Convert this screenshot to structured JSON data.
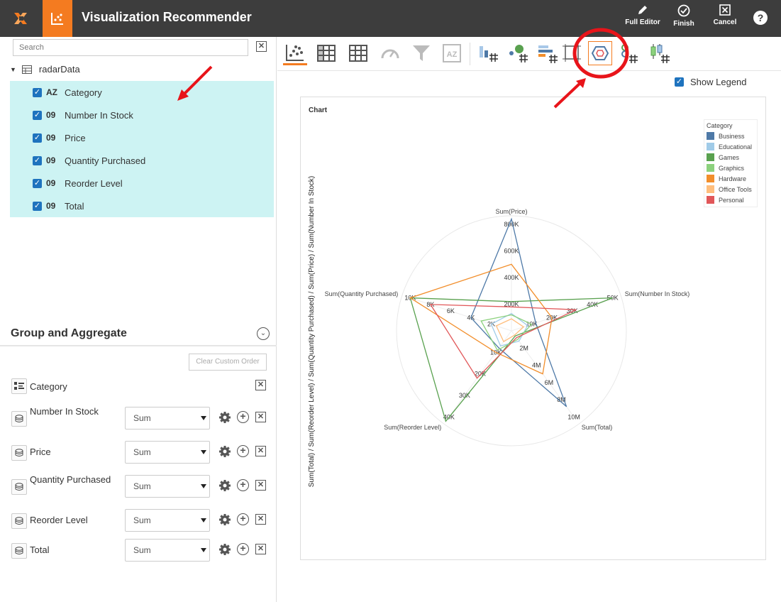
{
  "app": {
    "title": "Visualization Recommender"
  },
  "topbar": {
    "full_editor_label": "Full Editor",
    "finish_label": "Finish",
    "cancel_label": "Cancel",
    "help_label": "?"
  },
  "left": {
    "search_placeholder": "Search",
    "root_label": "radarData",
    "fields": [
      {
        "type": "AZ",
        "label": "Category"
      },
      {
        "type": "09",
        "label": "Number In Stock"
      },
      {
        "type": "09",
        "label": "Price"
      },
      {
        "type": "09",
        "label": "Quantity Purchased"
      },
      {
        "type": "09",
        "label": "Reorder Level"
      },
      {
        "type": "09",
        "label": "Total"
      }
    ]
  },
  "group": {
    "title": "Group and Aggregate",
    "clear_order_label": "Clear Custom Order",
    "category_label": "Category",
    "rows": [
      {
        "label": "Number In Stock",
        "agg": "Sum"
      },
      {
        "label": "Price",
        "agg": "Sum"
      },
      {
        "label": "Quantity Purchased",
        "agg": "Sum"
      },
      {
        "label": "Reorder Level",
        "agg": "Sum"
      },
      {
        "label": "Total",
        "agg": "Sum"
      }
    ]
  },
  "right": {
    "show_legend_label": "Show Legend",
    "show_legend_checked": true
  },
  "chart_data": {
    "type": "radar",
    "title": "Chart",
    "ylabel": "Sum(Total) / Sum(Reorder Level) / Sum(Quantity Purchased) / Sum(Price) / Sum(Number In Stock)",
    "axes": [
      {
        "name": "Sum(Price)",
        "max": 800000,
        "ticks": [
          "200K",
          "400K",
          "600K",
          "800K"
        ]
      },
      {
        "name": "Sum(Number In Stock)",
        "max": 50000,
        "ticks": [
          "10K",
          "20K",
          "30K",
          "40K",
          "50K"
        ]
      },
      {
        "name": "Sum(Total)",
        "max": 10000000,
        "ticks": [
          "2M",
          "4M",
          "6M",
          "8M",
          "10M"
        ]
      },
      {
        "name": "Sum(Reorder Level)",
        "max": 40000,
        "ticks": [
          "10K",
          "20K",
          "30K",
          "40K"
        ]
      },
      {
        "name": "Sum(Quantity Purchased)",
        "max": 10000,
        "ticks": [
          "2K",
          "4K",
          "6K",
          "8K",
          "10K"
        ]
      }
    ],
    "legend_title": "Category",
    "legend_position": "top-right",
    "series": [
      {
        "name": "Business",
        "color": "#4e79a7",
        "values": [
          860000,
          12000,
          8800000,
          8000,
          4000
        ]
      },
      {
        "name": "Educational",
        "color": "#a0cbe8",
        "values": [
          130000,
          8000,
          1200000,
          7000,
          2000
        ]
      },
      {
        "name": "Games",
        "color": "#59a14f",
        "values": [
          220000,
          50000,
          600000,
          42000,
          10000
        ]
      },
      {
        "name": "Graphics",
        "color": "#8cd17d",
        "values": [
          120000,
          10000,
          1000000,
          9000,
          3000
        ]
      },
      {
        "name": "Hardware",
        "color": "#f28e2b",
        "values": [
          500000,
          20000,
          5000000,
          10000,
          10000
        ]
      },
      {
        "name": "Office Tools",
        "color": "#ffbe7d",
        "values": [
          90000,
          6000,
          500000,
          5000,
          1500
        ]
      },
      {
        "name": "Personal",
        "color": "#e15759",
        "values": [
          180000,
          32000,
          800000,
          22000,
          8000
        ]
      }
    ]
  }
}
